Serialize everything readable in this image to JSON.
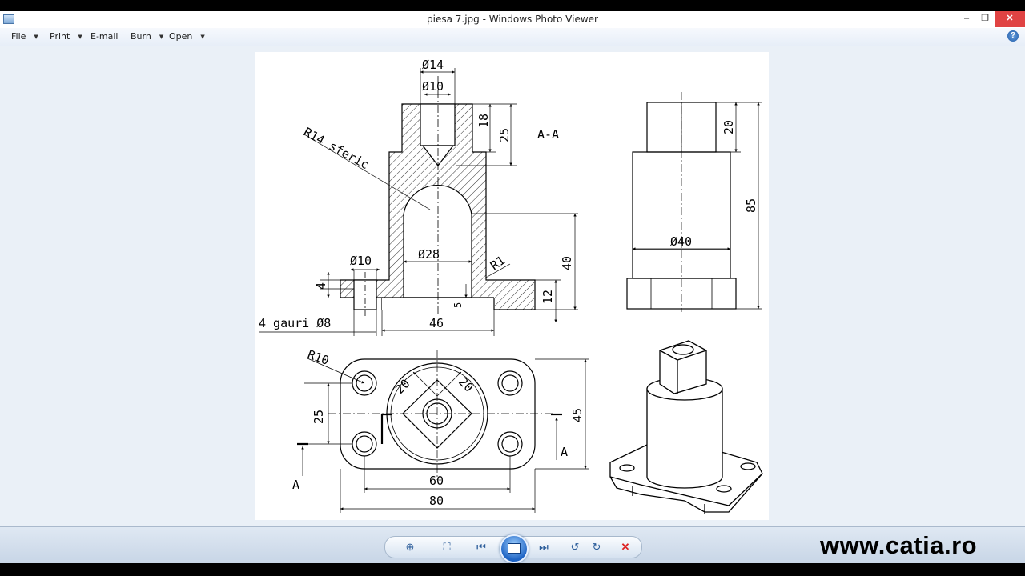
{
  "window": {
    "title": "piesa 7.jpg - Windows Photo Viewer",
    "controls": {
      "minimize": "–",
      "maximize": "❐",
      "close": "✕"
    }
  },
  "menu": {
    "file": "File",
    "print": "Print",
    "email": "E-mail",
    "burn": "Burn",
    "open": "Open",
    "help_glyph": "?"
  },
  "drawing": {
    "section_label": "A-A",
    "dims": {
      "d14": "Ø14",
      "d10_top": "Ø10",
      "h18": "18",
      "h25": "25",
      "r14": "R14 sferic",
      "d28": "Ø28",
      "r1": "R1",
      "h40": "40",
      "d10_left": "Ø10",
      "h4": "4",
      "h12": "12",
      "h5": "5",
      "holes": "4 gauri Ø8",
      "w46": "46",
      "h20_right": "20",
      "d40": "Ø40",
      "h85": "85",
      "r10": "R10",
      "d20a": "20",
      "d20b": "20",
      "h25_plan": "25",
      "h45": "45",
      "w60": "60",
      "w80": "80",
      "cut_a_left": "A",
      "cut_a_right": "A"
    }
  },
  "toolbar": {
    "zoom_icon": "magnifier-icon",
    "fit_icon": "fit-icon",
    "prev_icon": "previous-icon",
    "slideshow_icon": "slideshow-icon",
    "next_icon": "next-icon",
    "rotate_ccw_icon": "rotate-ccw-icon",
    "rotate_cw_icon": "rotate-cw-icon",
    "delete_icon": "delete-icon"
  },
  "watermark": "www.catia.ro"
}
